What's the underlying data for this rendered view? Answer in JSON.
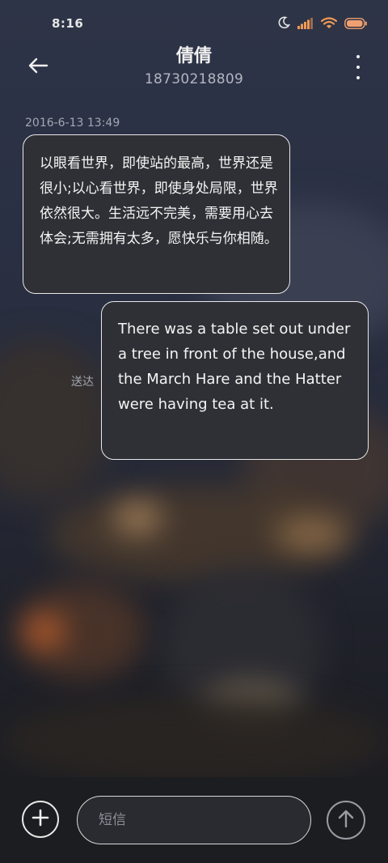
{
  "status_bar": {
    "time": "8:16",
    "icons": [
      "moon-icon",
      "signal-icon",
      "wifi-icon",
      "battery-icon"
    ]
  },
  "header": {
    "back_icon": "arrow-left-icon",
    "contact_name": "倩倩",
    "contact_number": "18730218809",
    "more_icon": "more-vertical-icon"
  },
  "conversation": {
    "timestamp": "2016-6-13 13:49",
    "messages": [
      {
        "direction": "incoming",
        "text": "以眼看世界，即使站的最高，世界还是很小;以心看世界，即使身处局限，世界依然很大。生活远不完美，需要用心去体会;无需拥有太多，愿快乐与你相随。"
      },
      {
        "direction": "outgoing",
        "text": "There was a table set out under a tree in front of the house,and the March Hare and the Hatter were having tea at it.",
        "status": "送达"
      }
    ]
  },
  "composer": {
    "add_icon": "plus-icon",
    "input_value": "",
    "input_placeholder": "短信",
    "send_icon": "arrow-up-icon"
  },
  "colors": {
    "bubble_background": "#2f3036",
    "bubble_border": "#e8e8e8",
    "battery_fill": "#f0a070",
    "wifi_color": "#f09a55"
  }
}
